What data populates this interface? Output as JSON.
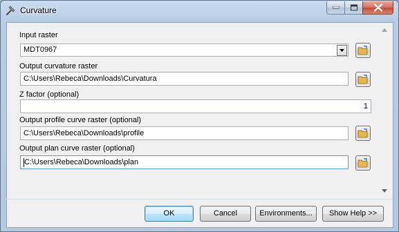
{
  "window": {
    "title": "Curvature"
  },
  "fields": {
    "input_raster": {
      "label": "Input raster",
      "value": "MDT0967"
    },
    "output_curvature": {
      "label": "Output curvature raster",
      "value": "C:\\Users\\Rebeca\\Downloads\\Curvatura"
    },
    "z_factor": {
      "label": "Z factor (optional)",
      "value": "1"
    },
    "output_profile": {
      "label": "Output profile curve raster (optional)",
      "value": "C:\\Users\\Rebeca\\Downloads\\profile"
    },
    "output_plan": {
      "label": "Output plan curve raster (optional)",
      "value": "C:\\Users\\Rebeca\\Downloads\\plan"
    }
  },
  "buttons": {
    "ok": "OK",
    "cancel": "Cancel",
    "environments": "Environments...",
    "show_help": "Show Help >>"
  },
  "colors": {
    "title_bar": "#b8cde4",
    "close_button": "#c5492f",
    "focus_border": "#569de5",
    "folder": "#e8b84a"
  },
  "icons": [
    "tool-hammer-icon",
    "minimize-icon",
    "maximize-icon",
    "close-icon",
    "dropdown-arrow-icon",
    "browse-folder-icon",
    "scroll-up-icon",
    "scroll-down-icon"
  ]
}
